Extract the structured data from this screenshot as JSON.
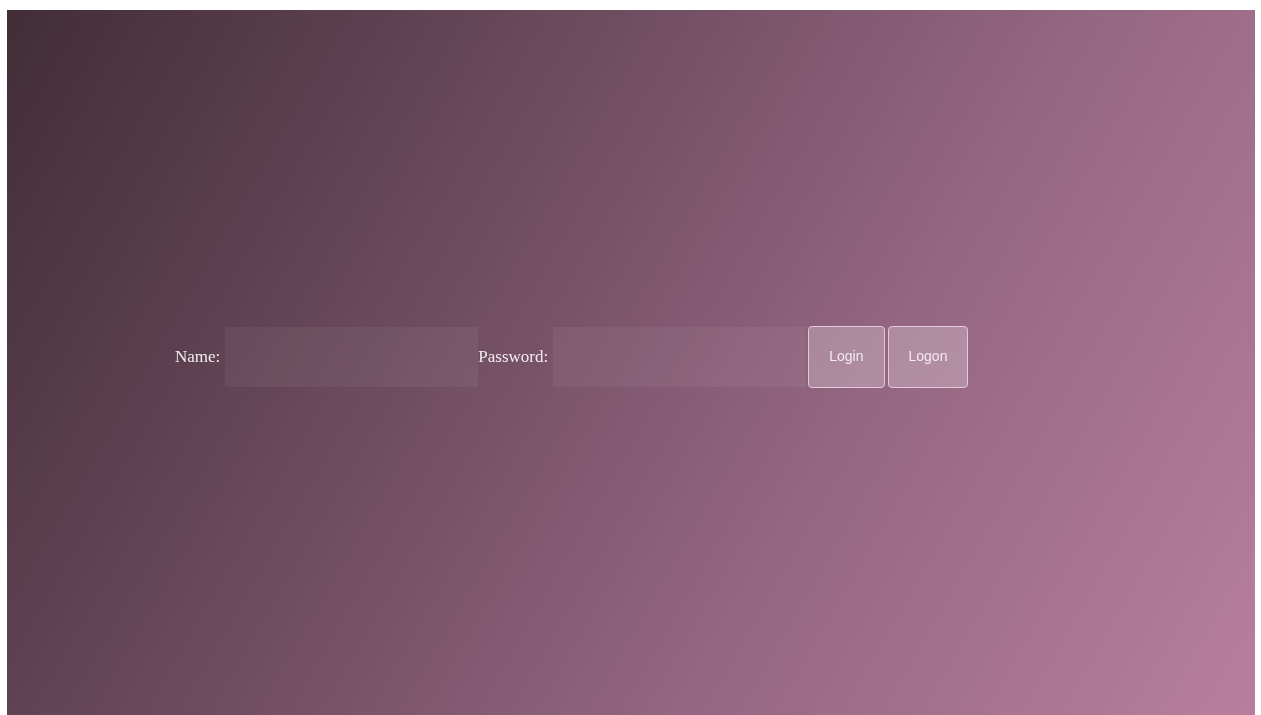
{
  "form": {
    "fields": [
      {
        "label": "Name:"
      },
      {
        "label": "Password:"
      }
    ],
    "buttons": [
      "Login",
      "Logon"
    ]
  }
}
